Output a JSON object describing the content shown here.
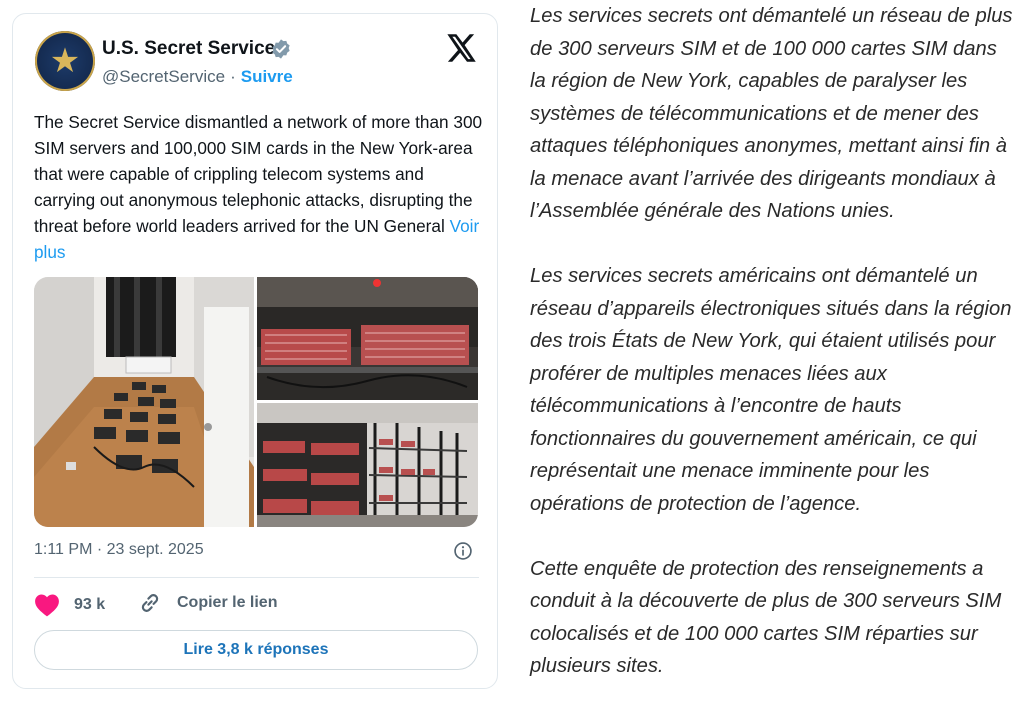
{
  "tweet": {
    "author_name": "U.S. Secret Service",
    "handle": "@SecretService",
    "separator": "·",
    "follow_label": "Suivre",
    "text": "The Secret Service dismantled a network of more than 300 SIM servers and 100,000 SIM cards in the New York-area that were capable of crippling telecom systems and carrying out anonymous telephonic attacks, disrupting the threat before world leaders arrived for the UN General",
    "more_label": "Voir plus",
    "timestamp": "1:11 PM · 23 sept. 2025",
    "likes": "93 k",
    "copy_link_label": "Copier le lien",
    "read_replies_label": "Lire 3,8 k réponses"
  },
  "icons": {
    "verified": "verified-badge-icon",
    "x_logo": "x-logo-icon",
    "info": "info-icon",
    "heart": "heart-icon",
    "link": "link-icon"
  },
  "colors": {
    "link_blue": "#1d9bf0",
    "heart": "#f91880",
    "text": "#0f1419",
    "muted": "#536471"
  },
  "article": {
    "paragraphs": [
      "Les services secrets ont démantelé un réseau de plus de 300 serveurs SIM et de 100 000 cartes SIM dans la région de New York, capables de paralyser les systèmes de télécommunications et de mener des attaques téléphoniques anonymes, mettant ainsi fin à la menace avant l’arrivée des dirigeants mondiaux à l’Assemblée générale des Nations unies.",
      "Les services secrets américains ont démantelé un réseau d’appareils électroniques situés dans la région des trois États de New York, qui étaient utilisés pour proférer de multiples menaces liées aux télécommunications à l’encontre de hauts fonctionnaires du gouvernement américain, ce qui représentait une menace imminente pour les opérations de protection de l’agence.",
      "Cette enquête de protection des renseignements a conduit à la découverte de plus de 300 serveurs SIM colocalisés et de 100 000 cartes SIM réparties sur plusieurs sites."
    ]
  }
}
